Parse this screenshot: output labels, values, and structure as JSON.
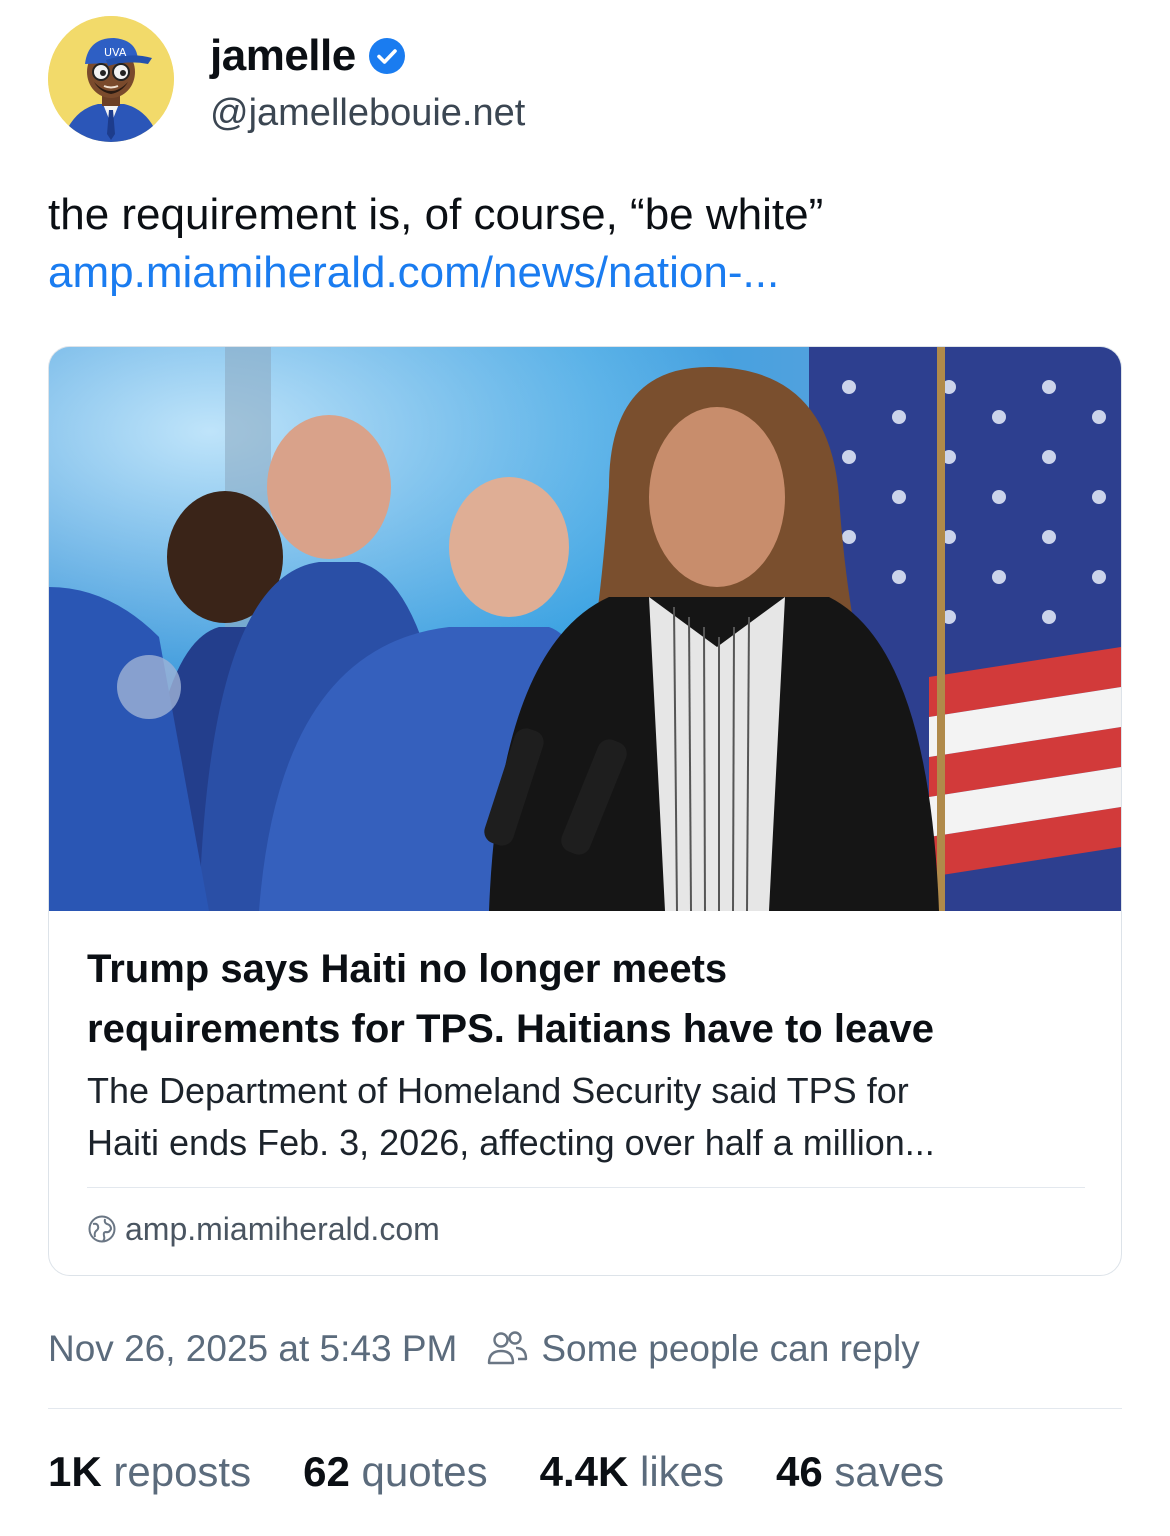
{
  "author": {
    "display_name": "jamelle",
    "handle": "@jamellebouie.net",
    "verified": true,
    "avatar_cap_text": "UVA"
  },
  "post": {
    "text_lines": [
      "the requirement is, of course, “be white”"
    ],
    "link_text": "amp.miamiherald.com/news/nation-..."
  },
  "card": {
    "image_icon": "news-photo",
    "title_lines": [
      "Trump says Haiti no longer meets",
      "requirements for TPS. Haitians have to leave"
    ],
    "description_lines": [
      "The Department of Homeland Security said TPS for",
      "Haiti ends Feb. 3, 2026, affecting over half a million..."
    ],
    "domain": "amp.miamiherald.com"
  },
  "meta": {
    "timestamp": "Nov 26, 2025 at 5:43 PM",
    "reply_setting": "Some people can reply",
    "reply_icon": "people-icon"
  },
  "stats": [
    {
      "value": "1K",
      "label": "reposts"
    },
    {
      "value": "62",
      "label": "quotes"
    },
    {
      "value": "4.4K",
      "label": "likes"
    },
    {
      "value": "46",
      "label": "saves"
    }
  ],
  "colors": {
    "link": "#1a7cf0",
    "verified": "#1a7cf0",
    "muted": "#5b6b7c",
    "avatar_bg": "#f2da6a"
  }
}
